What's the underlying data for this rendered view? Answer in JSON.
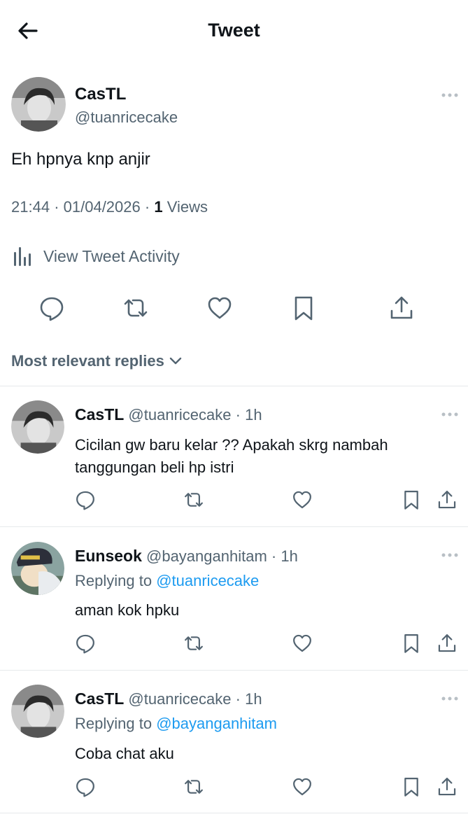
{
  "header": {
    "title": "Tweet"
  },
  "tweet": {
    "author_name": "CasTL",
    "author_handle": "@tuanricecake",
    "text": "Eh hpnya knp anjir",
    "time": "21:44",
    "date": "01/04/2026",
    "views_count": "1",
    "views_label": "Views",
    "separator": "·",
    "activity_label": "View Tweet Activity"
  },
  "replies_filter": {
    "label": "Most relevant replies"
  },
  "replies": [
    {
      "name": "CasTL",
      "handle": "@tuanricecake",
      "time": "1h",
      "text": "Cicilan gw baru kelar ?? Apakah skrg nambah tanggungan beli hp istri"
    },
    {
      "name": "Eunseok",
      "handle": "@bayanganhitam",
      "time": "1h",
      "replying_prefix": "Replying to",
      "replying_to": "@tuanricecake",
      "text": "aman kok hpku"
    },
    {
      "name": "CasTL",
      "handle": "@tuanricecake",
      "time": "1h",
      "replying_prefix": "Replying to",
      "replying_to": "@bayanganhitam",
      "text": "Coba chat aku"
    }
  ],
  "colors": {
    "text_primary": "#0f1419",
    "text_secondary": "#536471",
    "link": "#1d9bf0",
    "divider": "#e6e9eb"
  },
  "icons": [
    "back-arrow-icon",
    "more-dots-icon",
    "activity-bars-icon",
    "reply-icon",
    "retweet-icon",
    "like-icon",
    "bookmark-icon",
    "share-icon",
    "chevron-down-icon"
  ]
}
